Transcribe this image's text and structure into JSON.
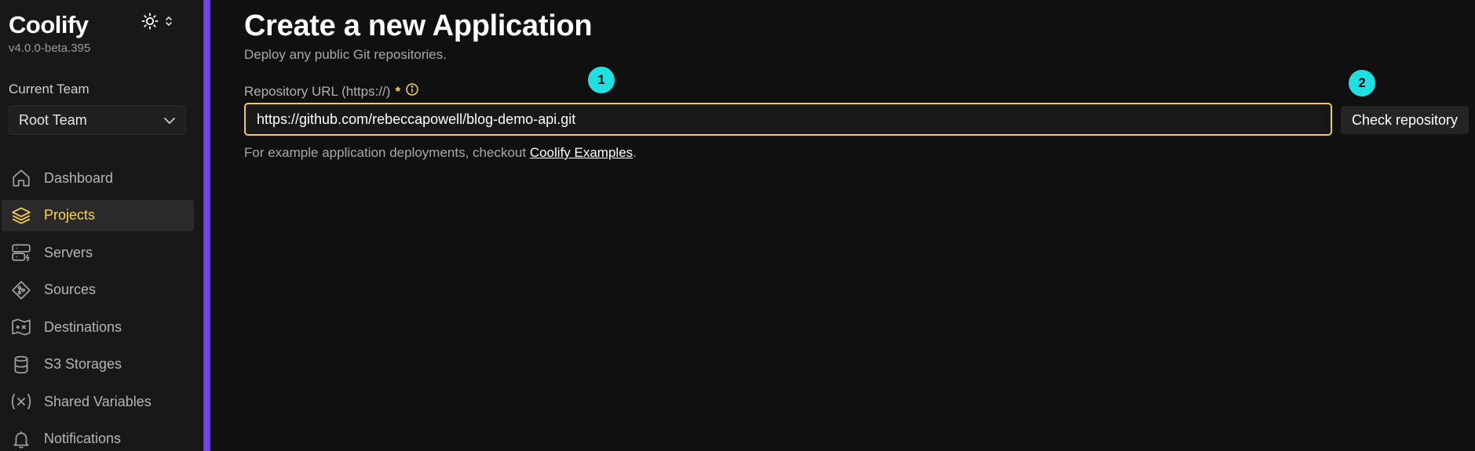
{
  "sidebar": {
    "brand": "Coolify",
    "version": "v4.0.0-beta.395",
    "team_label": "Current Team",
    "team_selected": "Root Team",
    "items": [
      {
        "label": "Dashboard",
        "icon": "home-icon"
      },
      {
        "label": "Projects",
        "icon": "layers-icon",
        "active": true
      },
      {
        "label": "Servers",
        "icon": "server-icon"
      },
      {
        "label": "Sources",
        "icon": "git-icon"
      },
      {
        "label": "Destinations",
        "icon": "destination-icon"
      },
      {
        "label": "S3 Storages",
        "icon": "database-icon"
      },
      {
        "label": "Shared Variables",
        "icon": "variable-icon"
      },
      {
        "label": "Notifications",
        "icon": "bell-icon"
      }
    ]
  },
  "main": {
    "title": "Create a new Application",
    "subtitle": "Deploy any public Git repositories.",
    "field_label": "Repository URL (https://)",
    "required_mark": "*",
    "url_value": "https://github.com/rebeccapowell/blog-demo-api.git",
    "check_button": "Check repository",
    "hint_prefix": "For example application deployments, checkout",
    "hint_link": "Coolify Examples",
    "hint_suffix": "."
  },
  "markers": [
    "1",
    "2"
  ],
  "colors": {
    "accent": "#fcd34d",
    "sidebar_edge": "#6b3cf0",
    "marker": "#1fe0e0"
  }
}
